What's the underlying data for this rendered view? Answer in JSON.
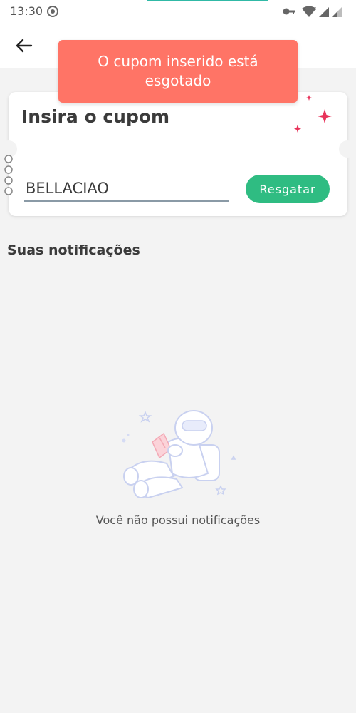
{
  "status_bar": {
    "time": "13:30",
    "icons": [
      "radio-icon",
      "key-icon",
      "wifi-icon",
      "signal-icon",
      "signal-icon"
    ]
  },
  "header": {
    "back_icon": "arrow-left-icon"
  },
  "toast": {
    "message": "O cupom inserido está esgotado",
    "color": "#ff7466"
  },
  "coupon": {
    "title": "Insira o cupom",
    "input_value": "BELLACIAO",
    "button_label": "Resgatar",
    "button_color": "#2fbc82",
    "sparkle_color": "#e8335a"
  },
  "notifications": {
    "title": "Suas notificações",
    "empty_message": "Você não possui notificações",
    "illustration": "astronaut-reading-illustration"
  }
}
